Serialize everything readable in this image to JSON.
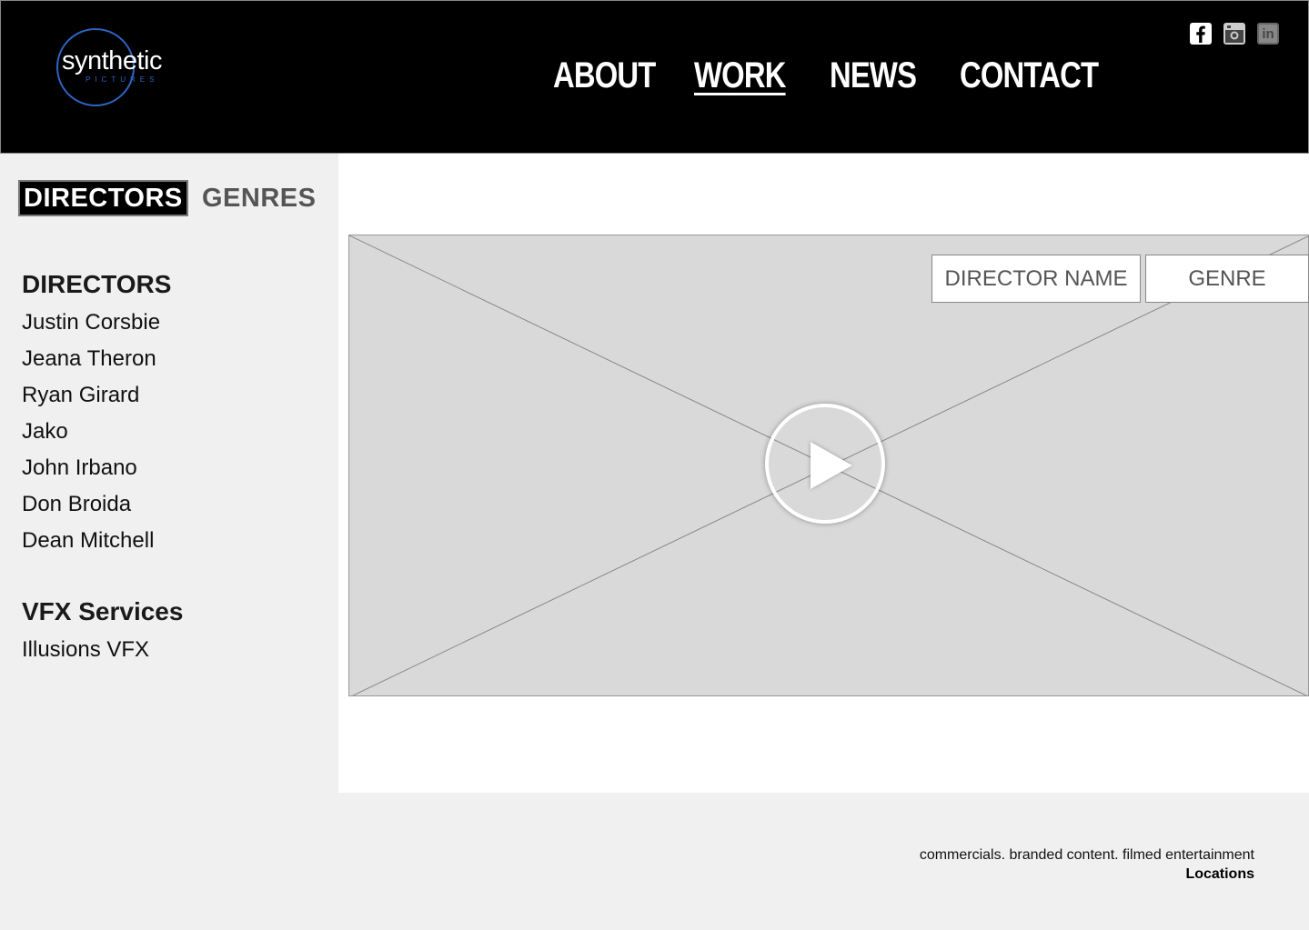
{
  "brand": {
    "name": "synthetic",
    "sub": "PICTURES",
    "accent": "#2f63c4"
  },
  "nav": [
    {
      "label": "ABOUT",
      "active": false
    },
    {
      "label": "WORK",
      "active": true
    },
    {
      "label": "NEWS",
      "active": false
    },
    {
      "label": "CONTACT",
      "active": false
    }
  ],
  "social": [
    "facebook-icon",
    "instagram-icon",
    "linkedin-icon"
  ],
  "social_labels": {
    "linkedin": "in"
  },
  "tabs": {
    "directors": "DIRECTORS",
    "genres": "GENRES"
  },
  "directors": {
    "title": "DIRECTORS",
    "items": [
      "Justin Corsbie",
      "Jeana Theron",
      "Ryan Girard",
      "Jako",
      "John Irbano",
      "Don Broida",
      "Dean Mitchell"
    ]
  },
  "vfx": {
    "title": "VFX Services",
    "items": [
      "Illusions VFX"
    ]
  },
  "filters": {
    "director": "DIRECTOR NAME",
    "genre": "GENRE"
  },
  "footer": {
    "tagline": "commercials. branded content. filmed entertainment",
    "locations": "Locations"
  }
}
